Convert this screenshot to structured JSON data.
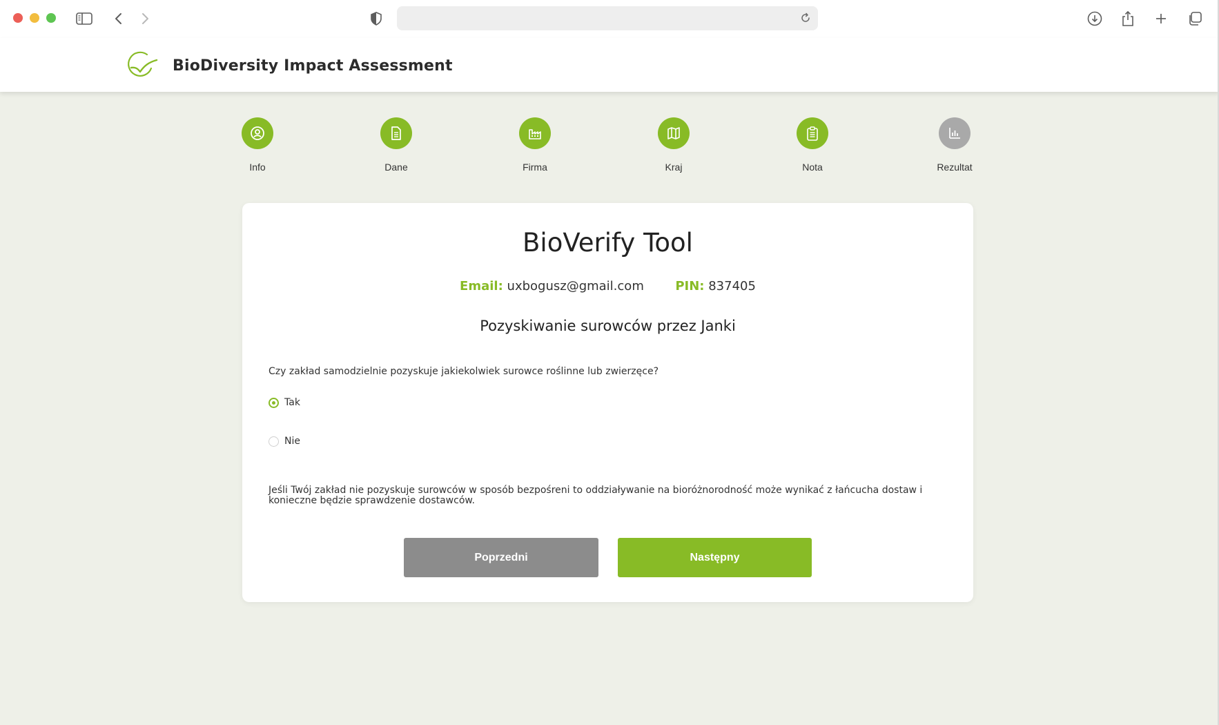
{
  "browser": {
    "icons": [
      "sidebar-icon",
      "back-icon",
      "forward-icon",
      "shield-icon",
      "reload-icon",
      "download-icon",
      "share-icon",
      "new-tab-icon",
      "tabs-overview-icon"
    ],
    "url": ""
  },
  "header": {
    "title": "BioDiversity Impact Assessment"
  },
  "steps": [
    {
      "label": "Info",
      "icon": "user-circle-icon",
      "state": "done"
    },
    {
      "label": "Dane",
      "icon": "document-icon",
      "state": "done"
    },
    {
      "label": "Firma",
      "icon": "factory-icon",
      "state": "done"
    },
    {
      "label": "Kraj",
      "icon": "map-icon",
      "state": "done"
    },
    {
      "label": "Nota",
      "icon": "clipboard-icon",
      "state": "done"
    },
    {
      "label": "Rezultat",
      "icon": "bar-chart-icon",
      "state": "pending"
    }
  ],
  "card": {
    "title": "BioVerify Tool",
    "email_label": "Email:",
    "email_value": "uxbogusz@gmail.com",
    "pin_label": "PIN:",
    "pin_value": "837405",
    "section_title": "Pozyskiwanie surowców przez Janki",
    "question": "Czy zakład samodzielnie pozyskuje jakiekolwiek surowce roślinne lub zwierzęce?",
    "options": [
      {
        "label": "Tak",
        "checked": true
      },
      {
        "label": "Nie",
        "checked": false
      }
    ],
    "note": "Jeśli Twój zakład nie pozyskuje surowców w sposób bezpośreni to oddziaływanie na bioróżnorodność może wynikać z łańcucha dostaw i konieczne będzie sprawdzenie dostawców.",
    "prev_label": "Poprzedni",
    "next_label": "Następny"
  },
  "colors": {
    "accent": "#88bb26",
    "pending": "#a9a9a9",
    "background": "#eef0e8",
    "prev_button": "#8c8c8c"
  }
}
